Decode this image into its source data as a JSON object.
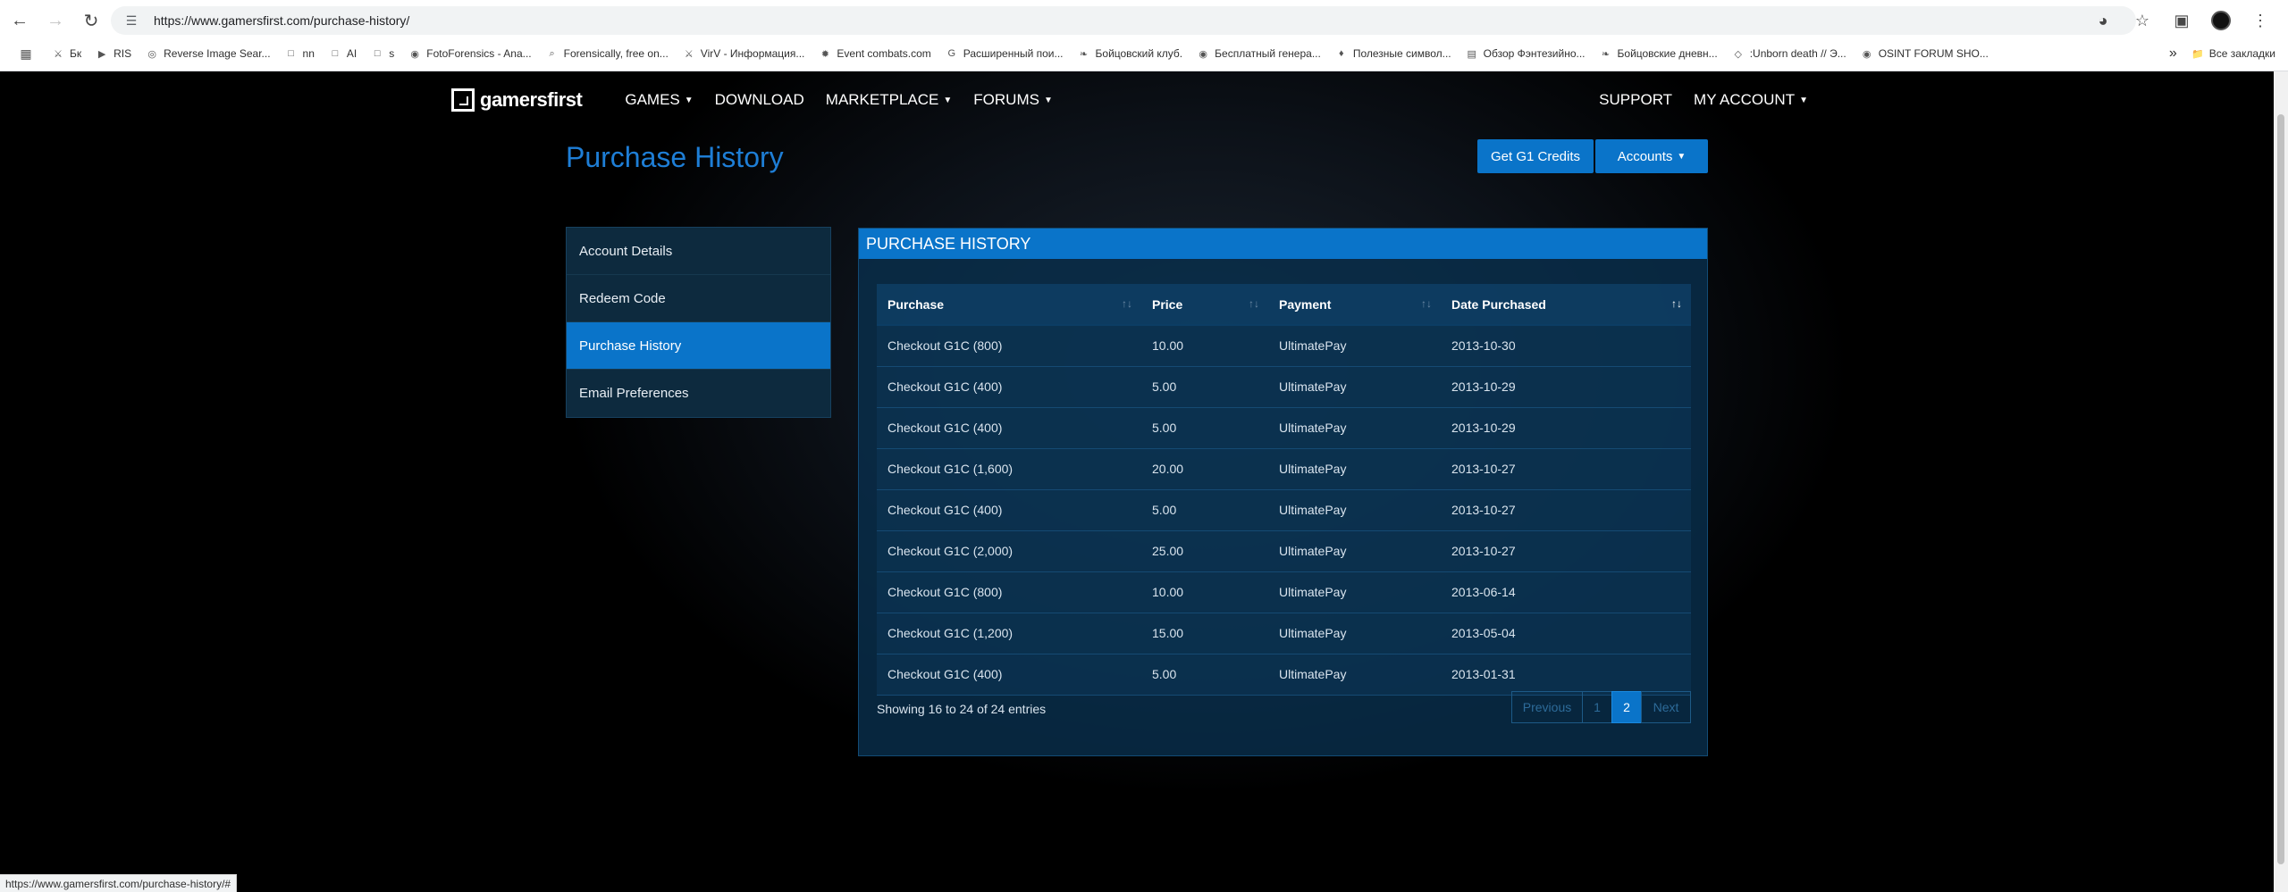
{
  "browser": {
    "url": "https://www.gamersfirst.com/purchase-history/",
    "bookmarks": [
      {
        "label": "Бк",
        "icon": "swords-icon"
      },
      {
        "label": "RIS",
        "icon": "play-icon"
      },
      {
        "label": "Reverse Image Sear...",
        "icon": "c-logo-icon"
      },
      {
        "label": "nn",
        "icon": "folder-icon"
      },
      {
        "label": "AI",
        "icon": "folder-icon"
      },
      {
        "label": "s",
        "icon": "folder-icon"
      },
      {
        "label": "FotoForensics - Ana...",
        "icon": "globe-icon"
      },
      {
        "label": "Forensically, free on...",
        "icon": "magnifier-icon"
      },
      {
        "label": "VirV - Информация...",
        "icon": "swords-icon"
      },
      {
        "label": "Event combats.com",
        "icon": "sun-icon"
      },
      {
        "label": "Расширенный пои...",
        "icon": "g-logo-icon"
      },
      {
        "label": "Бойцовский клуб.",
        "icon": "dragon-icon"
      },
      {
        "label": "Бесплатный генера...",
        "icon": "circle-icon"
      },
      {
        "label": "Полезные символ...",
        "icon": "gem-icon"
      },
      {
        "label": "Обзор Фэнтезийно...",
        "icon": "book-icon"
      },
      {
        "label": "Бойцовские дневн...",
        "icon": "dragon-icon"
      },
      {
        "label": ":Unborn death // Э...",
        "icon": "diamond-icon"
      },
      {
        "label": "OSINT FORUM SHO...",
        "icon": "globe-icon"
      }
    ],
    "all_bookmarks": "Все закладки",
    "status_url": "https://www.gamersfirst.com/purchase-history/#"
  },
  "site": {
    "logo": "gamersfirst",
    "nav": {
      "games": "GAMES",
      "download": "DOWNLOAD",
      "marketplace": "MARKETPLACE",
      "forums": "FORUMS",
      "support": "SUPPORT",
      "my_account": "MY ACCOUNT"
    }
  },
  "page": {
    "title": "Purchase History",
    "btn_credits": "Get G1 Credits",
    "btn_accounts": "Accounts"
  },
  "sidebar": {
    "items": [
      {
        "label": "Account Details"
      },
      {
        "label": "Redeem Code"
      },
      {
        "label": "Purchase History"
      },
      {
        "label": "Email Preferences"
      }
    ]
  },
  "panel": {
    "heading": "PURCHASE HISTORY",
    "columns": {
      "purchase": "Purchase",
      "price": "Price",
      "payment": "Payment",
      "date": "Date Purchased"
    },
    "rows": [
      [
        "Checkout G1C (800)",
        "10.00",
        "UltimatePay",
        "2013-10-30"
      ],
      [
        "Checkout G1C (400)",
        "5.00",
        "UltimatePay",
        "2013-10-29"
      ],
      [
        "Checkout G1C (400)",
        "5.00",
        "UltimatePay",
        "2013-10-29"
      ],
      [
        "Checkout G1C (1,600)",
        "20.00",
        "UltimatePay",
        "2013-10-27"
      ],
      [
        "Checkout G1C (400)",
        "5.00",
        "UltimatePay",
        "2013-10-27"
      ],
      [
        "Checkout G1C (2,000)",
        "25.00",
        "UltimatePay",
        "2013-10-27"
      ],
      [
        "Checkout G1C (800)",
        "10.00",
        "UltimatePay",
        "2013-06-14"
      ],
      [
        "Checkout G1C (1,200)",
        "15.00",
        "UltimatePay",
        "2013-05-04"
      ],
      [
        "Checkout G1C (400)",
        "5.00",
        "UltimatePay",
        "2013-01-31"
      ]
    ],
    "info": "Showing 16 to 24 of 24 entries",
    "pager": {
      "previous": "Previous",
      "page1": "1",
      "page2": "2",
      "next": "Next"
    }
  }
}
